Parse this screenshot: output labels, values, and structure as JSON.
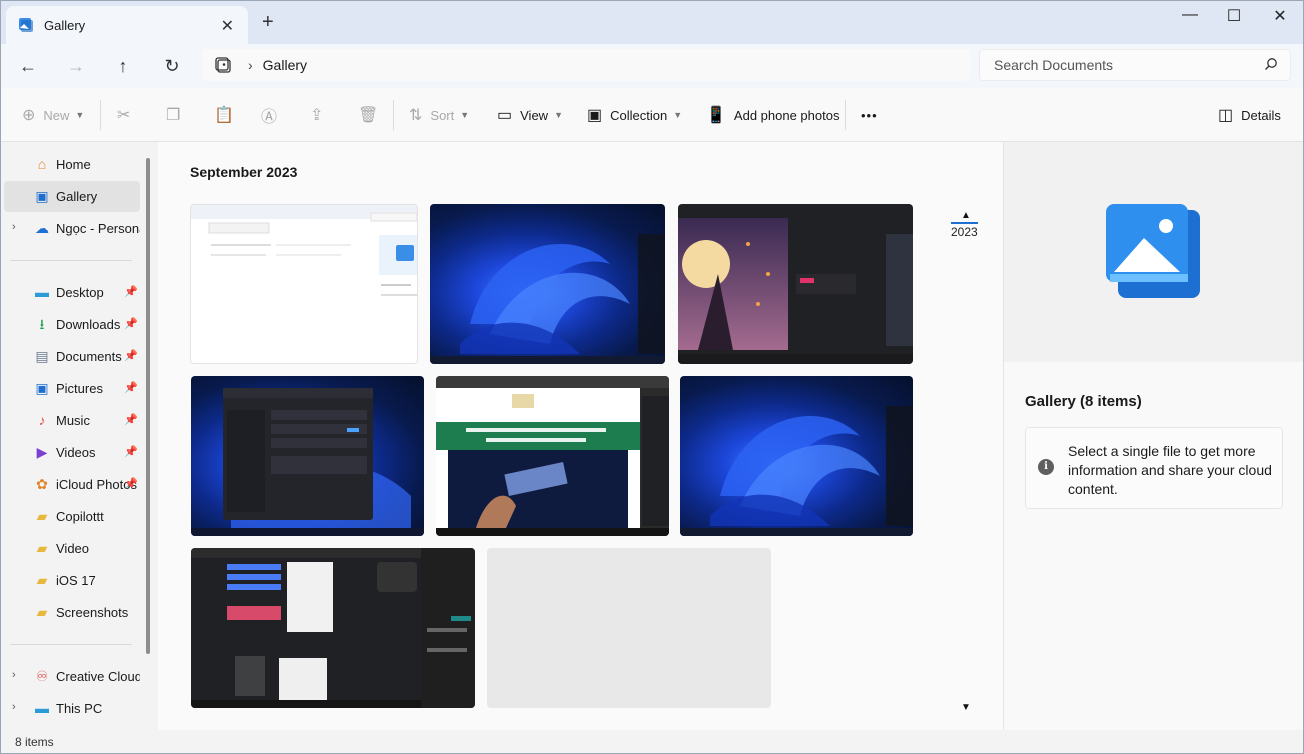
{
  "window": {
    "tab_title": "Gallery",
    "tab_close": "✕",
    "new_tab": "+",
    "minimize": "—",
    "maximize": "☐",
    "close": "✕"
  },
  "navbar": {
    "back": "←",
    "forward": "→",
    "up": "↑",
    "refresh": "↻",
    "separator": "›",
    "breadcrumb": "Gallery",
    "search_placeholder": "Search Documents"
  },
  "command_bar": {
    "new_label": "New",
    "sort_label": "Sort",
    "view_label": "View",
    "collection_label": "Collection",
    "add_phone_photos_label": "Add phone photos",
    "more_label": "•••",
    "details_label": "Details"
  },
  "sidebar": {
    "items": [
      {
        "label": "Home"
      },
      {
        "label": "Gallery"
      },
      {
        "label": "Ngọc - Personal"
      },
      {
        "label": "Desktop"
      },
      {
        "label": "Downloads"
      },
      {
        "label": "Documents"
      },
      {
        "label": "Pictures"
      },
      {
        "label": "Music"
      },
      {
        "label": "Videos"
      },
      {
        "label": "iCloud Photos"
      },
      {
        "label": "Copilottt"
      },
      {
        "label": "Video"
      },
      {
        "label": "iOS 17"
      },
      {
        "label": "Screenshots"
      },
      {
        "label": "Creative Cloud Files"
      },
      {
        "label": "This PC"
      }
    ]
  },
  "main": {
    "month_heading": "September 2023",
    "timeline_year": "2023",
    "photos": [
      {
        "kind": "explorer-screenshot"
      },
      {
        "kind": "windows-bloom-wallpaper"
      },
      {
        "kind": "moon-lantern-screenshot"
      },
      {
        "kind": "personalization-settings-screenshot"
      },
      {
        "kind": "news-article-screenshot"
      },
      {
        "kind": "windows-bloom-wallpaper"
      },
      {
        "kind": "browser-chat-screenshot"
      },
      {
        "kind": "loading-placeholder"
      }
    ]
  },
  "details": {
    "title": "Gallery (8 items)",
    "info_text": "Select a single file to get more information and share your cloud content."
  },
  "status": {
    "item_count": "8 items"
  },
  "colors": {
    "accent": "#1f6fd1",
    "titlebar": "#dfe7f4",
    "selected_nav": "#e2e2e2"
  }
}
